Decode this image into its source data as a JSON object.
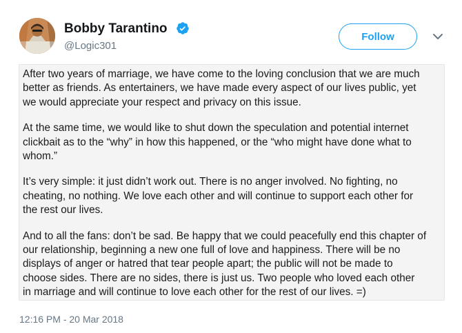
{
  "tweet": {
    "display_name": "Bobby Tarantino",
    "handle": "@Logic301",
    "follow_label": "Follow",
    "timestamp": "12:16 PM - 20 Mar 2018",
    "note_paragraphs": [
      "After two years of marriage, we have come to the loving conclusion that we are much\nbetter as friends.  As entertainers, we have made every aspect of our lives public, yet\nwe would appreciate your respect and privacy on this issue.",
      "At the same time, we would like to shut down the speculation and potential internet\nclickbait as to the “why” in how this happened, or the “who might have done what to\nwhom.”",
      "It’s very simple: it just didn’t work out.  There is no anger involved.  No fighting, no\ncheating, no nothing.  We love each other and will continue to support each other for\nthe rest our lives.",
      "And to all the fans: don’t be sad. Be happy that we could peacefully end this chapter of\nour relationship, beginning a new one full of love and happiness. There will be no\ndisplays of anger or hatred that tear people apart; the public will not be made to\nchoose sides.  There are no sides, there is just us. Two people who loved each other\nin marriage and will continue to love each other for the rest of our lives.  =)"
    ]
  },
  "icons": {
    "verified": "verified-badge-icon",
    "caret": "chevron-down-icon"
  },
  "colors": {
    "accent": "#1da1f2",
    "secondary_text": "#657786",
    "note_background": "#f4f4f4"
  }
}
